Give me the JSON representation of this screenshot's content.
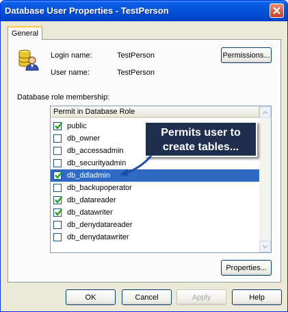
{
  "window": {
    "title": "Database User Properties - TestPerson"
  },
  "tabs": [
    {
      "label": "General"
    }
  ],
  "general": {
    "login_name_label": "Login name:",
    "login_name_value": "TestPerson",
    "user_name_label": "User name:",
    "user_name_value": "TestPerson",
    "permissions_button": "Permissions...",
    "role_membership_label": "Database role membership:",
    "column_header": "Permit in Database Role",
    "roles": [
      {
        "label": "public",
        "checked": true,
        "selected": false
      },
      {
        "label": "db_owner",
        "checked": false,
        "selected": false
      },
      {
        "label": "db_accessadmin",
        "checked": false,
        "selected": false
      },
      {
        "label": "db_securityadmin",
        "checked": false,
        "selected": false
      },
      {
        "label": "db_ddladmin",
        "checked": true,
        "selected": true
      },
      {
        "label": "db_backupoperator",
        "checked": false,
        "selected": false
      },
      {
        "label": "db_datareader",
        "checked": true,
        "selected": false
      },
      {
        "label": "db_datawriter",
        "checked": true,
        "selected": false
      },
      {
        "label": "db_denydatareader",
        "checked": false,
        "selected": false
      },
      {
        "label": "db_denydatawriter",
        "checked": false,
        "selected": false
      }
    ],
    "properties_button": "Properties..."
  },
  "callout": {
    "line1": "Permits user to",
    "line2": "create tables..."
  },
  "footer": {
    "ok": "OK",
    "cancel": "Cancel",
    "apply": "Apply",
    "help": "Help"
  },
  "colors": {
    "titlebar": "#0553d8",
    "selection": "#316ac5",
    "checkmark": "#21a121",
    "callout_bg": "#1f2d4f",
    "arrow": "#1d4fa8"
  },
  "icons": {
    "database": "database-user-icon",
    "close": "close-icon",
    "check": "checkmark-icon"
  }
}
